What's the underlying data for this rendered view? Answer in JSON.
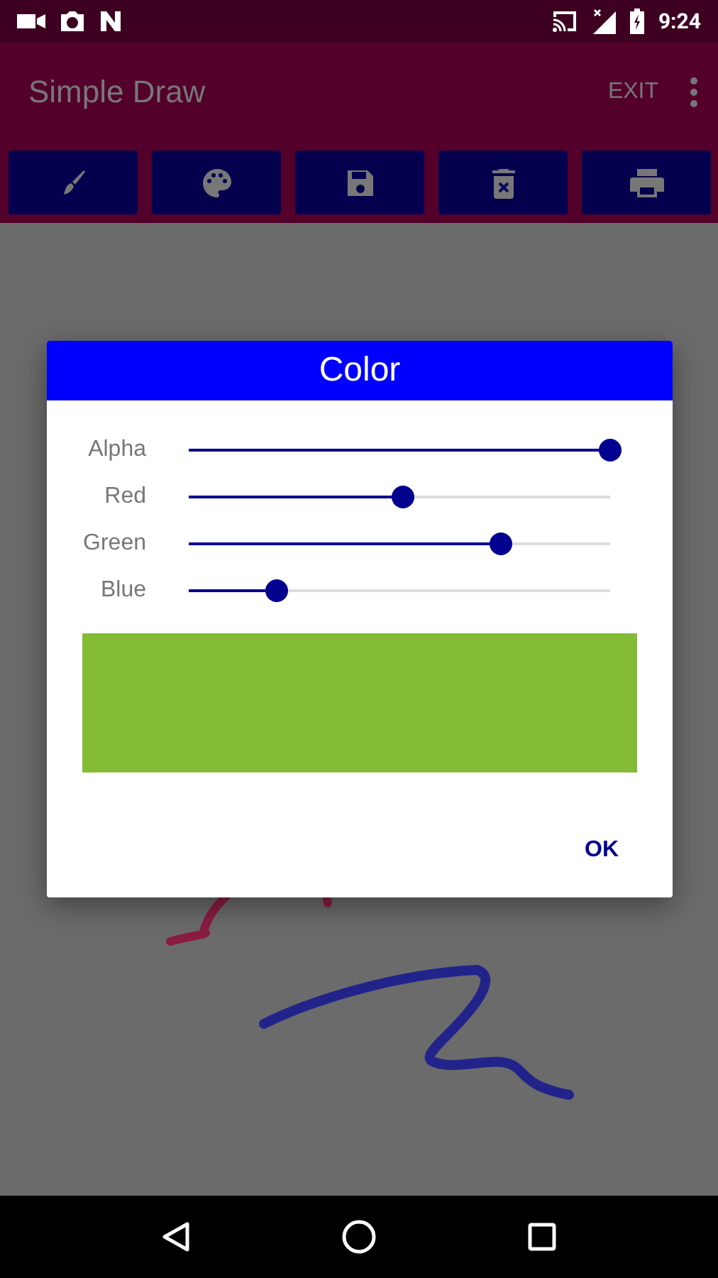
{
  "status_bar": {
    "time": "9:24"
  },
  "app_bar": {
    "title": "Simple Draw",
    "action": "EXIT"
  },
  "toolbar": [
    {
      "kind": "brush"
    },
    {
      "kind": "palette"
    },
    {
      "kind": "save"
    },
    {
      "kind": "delete"
    },
    {
      "kind": "print"
    }
  ],
  "dialog": {
    "title": "Color",
    "sliders": [
      {
        "label": "Alpha",
        "level": 1.0
      },
      {
        "label": "Red",
        "level": 0.51
      },
      {
        "label": "Green",
        "level": 0.74
      },
      {
        "label": "Blue",
        "level": 0.21
      }
    ],
    "preview": {
      "color": "#84bb34"
    },
    "button": "OK"
  }
}
